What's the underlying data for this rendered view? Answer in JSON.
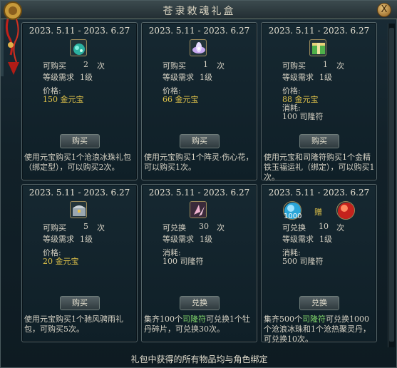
{
  "window": {
    "title": "苍隶敕魂礼盒",
    "close_label": "X"
  },
  "labels": {
    "purchasable": "可购买",
    "exchangeable": "可兑换",
    "times": "次",
    "level_req": "等级需求",
    "level_value": "1级",
    "price": "价格:",
    "consume": "消耗:"
  },
  "cards": [
    {
      "date": "2023. 5.11 - 2023. 6.27",
      "count_label": "可购买",
      "count": "2",
      "price_label": "价格:",
      "price": "150 金元宝",
      "button": "购买",
      "desc": "使用元宝购买1个沧浪冰珠礼包（绑定型），可以购买2次。",
      "icon": "green-gem-bag-icon"
    },
    {
      "date": "2023. 5.11 - 2023. 6.27",
      "count_label": "可购买",
      "count": "1",
      "price_label": "价格:",
      "price": "66 金元宝",
      "button": "购买",
      "desc": "使用元宝购买1个阵灵·伤心花，可以购买1次。",
      "icon": "lotus-flower-icon"
    },
    {
      "date": "2023. 5.11 - 2023. 6.27",
      "count_label": "可购买",
      "count": "1",
      "price_label": "价格:",
      "price": "88 金元宝",
      "consume_label": "消耗:",
      "consume": "100 司隆符",
      "button": "购买",
      "desc": "使用元宝和司隆符购买1个金精铁玉福运礼（绑定），可以购买1次。",
      "icon": "green-gift-book-icon"
    },
    {
      "date": "2023. 5.11 - 2023. 6.27",
      "count_label": "可购买",
      "count": "5",
      "price_label": "价格:",
      "price": "20 金元宝",
      "button": "购买",
      "desc": "使用元宝购买1个驰风骋雨礼包，可购买5次。",
      "icon": "treasure-chest-icon"
    },
    {
      "date": "2023. 5.11 - 2023. 6.27",
      "count_label": "可兑换",
      "count": "30",
      "price_label": "消耗:",
      "price": "100 司隆符",
      "button": "兑换",
      "desc_a": "集齐100个",
      "desc_hl": "司隆符",
      "desc_b": "可兑换1个牡丹碎片，可兑换30次。",
      "icon": "peony-fragment-icon"
    },
    {
      "date": "2023. 5.11 - 2023. 6.27",
      "count_label": "可兑换",
      "count": "10",
      "price_label": "消耗:",
      "price": "500 司隆符",
      "button": "兑换",
      "desc_a": "集齐500个",
      "desc_hl": "司隆符",
      "desc_b": "可兑换1000个沧浪冰珠和1个沧热聚灵丹，可兑换10次。",
      "icon": "blue-orb-icon",
      "icon2": "red-orb-icon",
      "badge": "1000",
      "gift_label": "赠"
    }
  ],
  "footer": "礼包中获得的所有物品均与角色绑定",
  "colors": {
    "gold": "#e3c54a",
    "highlight": "#7fd36a",
    "text": "#d7d2c4"
  }
}
